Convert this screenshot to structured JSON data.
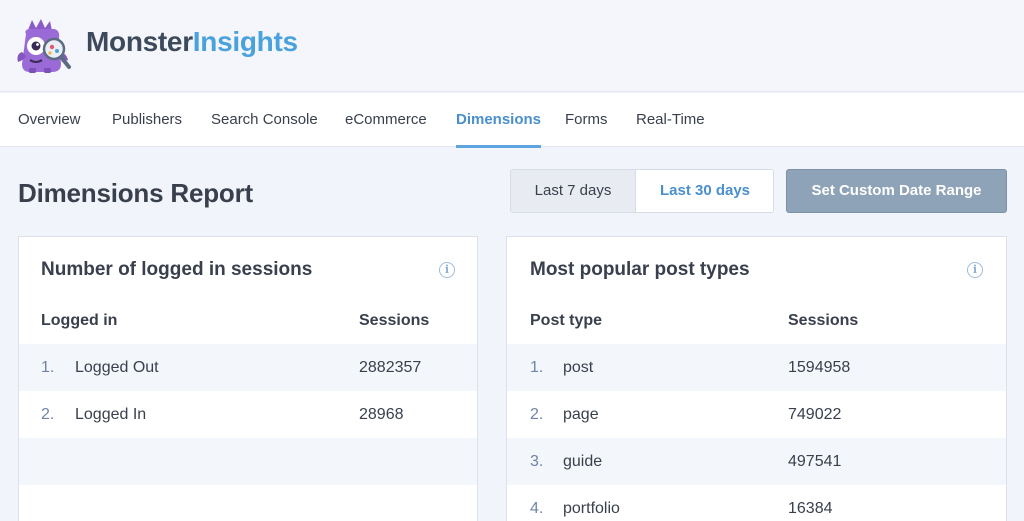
{
  "brand": {
    "name_part1": "Monster",
    "name_part2": "Insights",
    "logo_icon": "monster-mascot-icon",
    "accent_color": "#4aa2dc"
  },
  "nav": {
    "items": [
      {
        "label": "Overview"
      },
      {
        "label": "Publishers"
      },
      {
        "label": "Search Console"
      },
      {
        "label": "eCommerce"
      },
      {
        "label": "Dimensions",
        "active": true
      },
      {
        "label": "Forms"
      },
      {
        "label": "Real-Time"
      }
    ]
  },
  "page": {
    "title": "Dimensions Report"
  },
  "date_range": {
    "options": [
      {
        "label": "Last 7 days",
        "selected": false
      },
      {
        "label": "Last 30 days",
        "selected": true
      }
    ],
    "custom_label": "Set Custom Date Range"
  },
  "logged_in_card": {
    "title": "Number of logged in sessions",
    "info_icon": "info-icon",
    "columns": [
      "Logged in",
      "Sessions"
    ],
    "rows": [
      {
        "index": "1.",
        "label": "Logged Out",
        "value": "2882357"
      },
      {
        "index": "2.",
        "label": "Logged In",
        "value": "28968"
      }
    ]
  },
  "post_types_card": {
    "title": "Most popular post types",
    "info_icon": "info-icon",
    "columns": [
      "Post type",
      "Sessions"
    ],
    "rows": [
      {
        "index": "1.",
        "label": "post",
        "value": "1594958"
      },
      {
        "index": "2.",
        "label": "page",
        "value": "749022"
      },
      {
        "index": "3.",
        "label": "guide",
        "value": "497541"
      },
      {
        "index": "4.",
        "label": "portfolio",
        "value": "16384"
      }
    ]
  }
}
